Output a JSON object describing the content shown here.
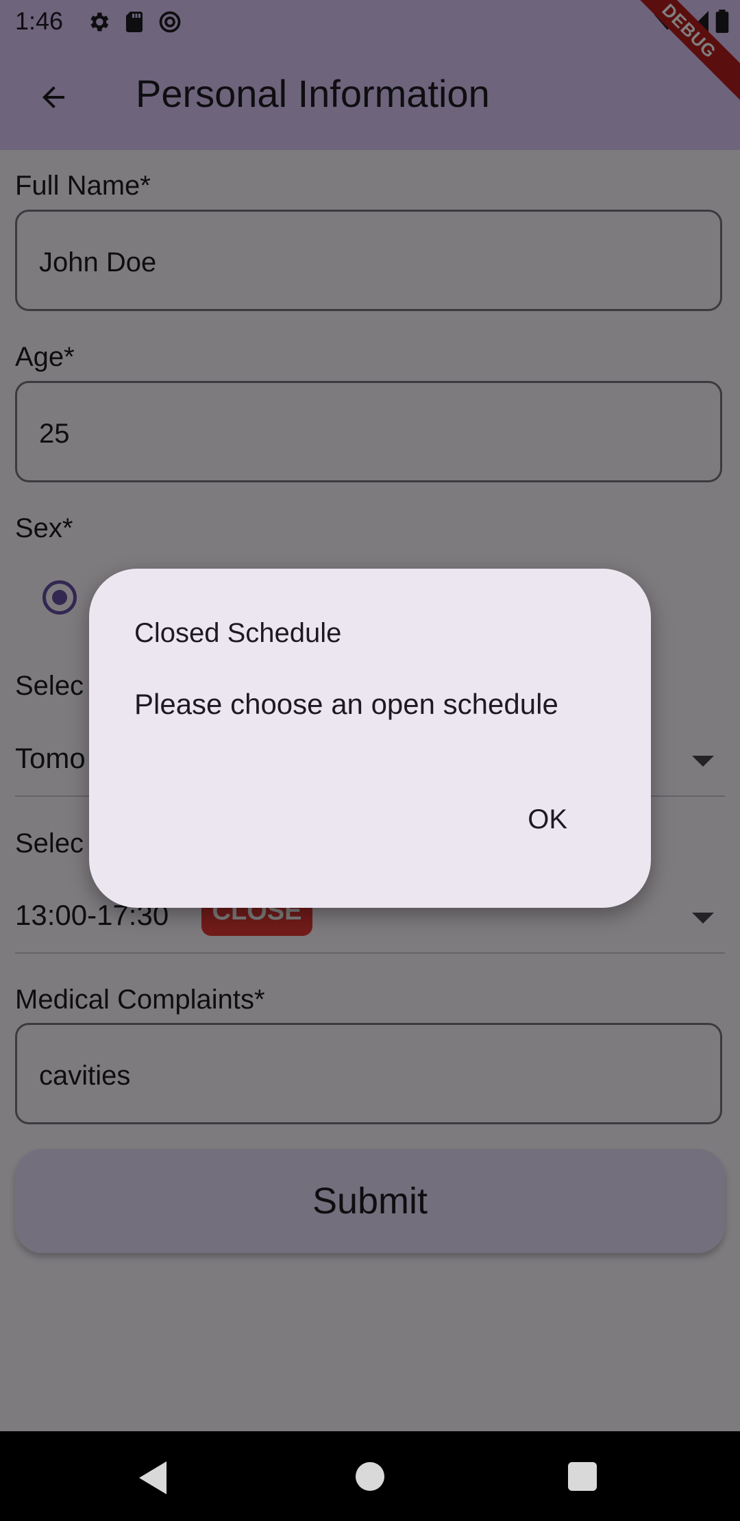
{
  "status_bar": {
    "time": "1:46"
  },
  "app_bar": {
    "title": "Personal Information",
    "debug_label": "DEBUG"
  },
  "form": {
    "full_name": {
      "label": "Full Name*",
      "value": "John Doe"
    },
    "age": {
      "label": "Age*",
      "value": "25"
    },
    "sex": {
      "label": "Sex*"
    },
    "select_date": {
      "label": "Selec",
      "value": "Tomo"
    },
    "select_time": {
      "label": "Selec",
      "value": "13:00-17:30",
      "badge": "CLOSE"
    },
    "medical": {
      "label": "Medical Complaints*",
      "value": "cavities"
    },
    "submit_label": "Submit"
  },
  "dialog": {
    "title": "Closed Schedule",
    "message": "Please choose an open schedule",
    "ok_label": "OK"
  },
  "colors": {
    "primary": "#6750a4",
    "app_bar": "#dcc9f9",
    "badge_red": "#e53935"
  }
}
